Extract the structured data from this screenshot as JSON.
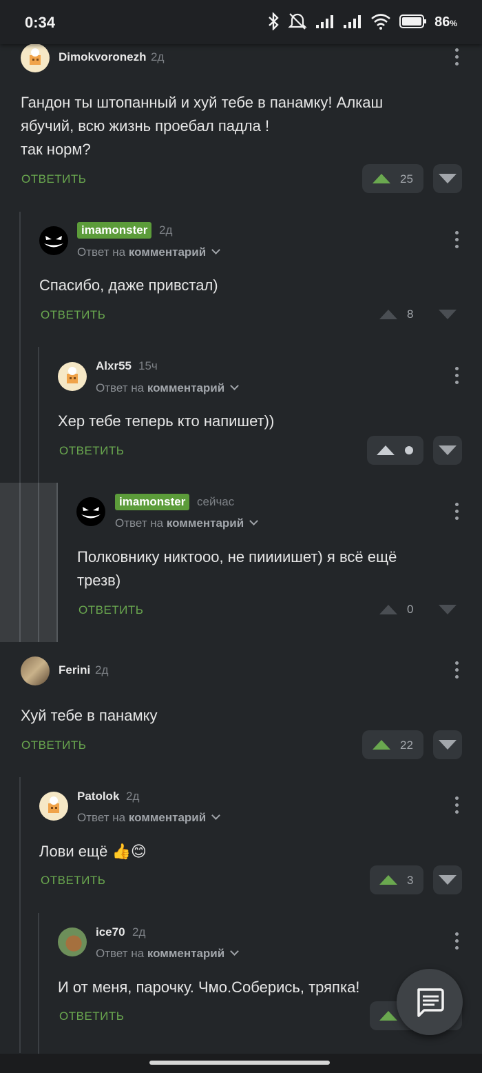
{
  "status": {
    "time": "0:34",
    "battery": "86",
    "battery_unit": "%",
    "icons": [
      "bluetooth-icon",
      "mute-icon",
      "signal-icon",
      "signal-icon",
      "wifi-icon",
      "battery-icon"
    ]
  },
  "common": {
    "reply_label": "ОТВЕТИТЬ",
    "reply_to_prefix": "Ответ на",
    "reply_to_target": "комментарий"
  },
  "comments": [
    {
      "author": "Dimokvoronezh",
      "time": "2д",
      "text_lines": [
        "Гандон ты штопанный и хуй тебе в панамку! Алкаш",
        "ябучий, всю жизнь проебал падла !",
        "так норм?"
      ],
      "score": "25"
    },
    {
      "author": "imamonster",
      "time": "2д",
      "text_lines": [
        "Спасибо, даже привстал)"
      ],
      "score": "8"
    },
    {
      "author": "Alxr55",
      "time": "15ч",
      "text_lines": [
        "Хер тебе теперь кто напишет))"
      ],
      "score": ""
    },
    {
      "author": "imamonster",
      "time": "сейчас",
      "text_lines": [
        "Полковнику никтооо, не пиииишет) я всё ещё",
        "трезв)"
      ],
      "score": "0"
    },
    {
      "author": "Ferini",
      "time": "2д",
      "text_lines": [
        "Хуй тебе в панамку"
      ],
      "score": "22"
    },
    {
      "author": "Patolok",
      "time": "2д",
      "text_lines": [
        "Лови ещё 👍😊"
      ],
      "score": "3"
    },
    {
      "author": "ice70",
      "time": "2д",
      "text_lines": [
        "И от меня, парочку. Чмо.Соберись, тряпка!"
      ],
      "score": ""
    }
  ],
  "colors": {
    "background": "#232629",
    "accent": "#6aa84f",
    "badge": "#5c9c3a"
  }
}
